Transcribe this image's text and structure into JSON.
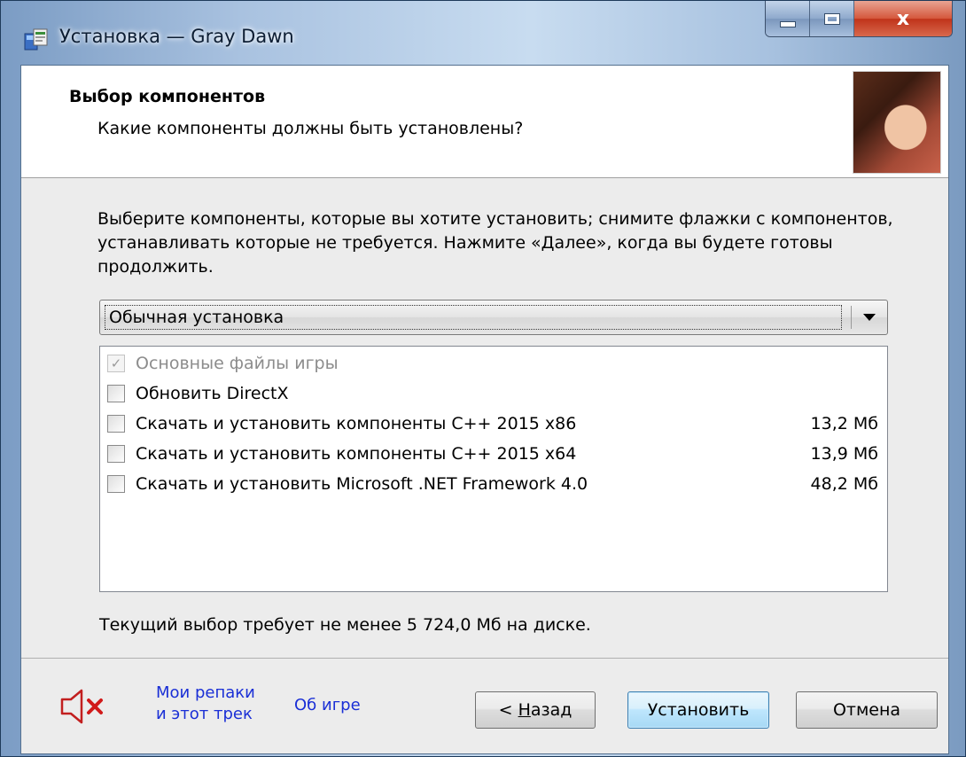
{
  "window": {
    "title": "Установка — Gray Dawn",
    "close_glyph": "x"
  },
  "header": {
    "title": "Выбор компонентов",
    "subtitle": "Какие компоненты должны быть установлены?"
  },
  "intro_text": "Выберите компоненты, которые вы хотите установить; снимите флажки с компонентов, устанавливать которые не требуется. Нажмите «Далее», когда вы будете готовы продолжить.",
  "setup_type": {
    "selected": "Обычная установка"
  },
  "components": [
    {
      "label": "Основные файлы игры",
      "size": "",
      "checked": true,
      "disabled": true
    },
    {
      "label": "Обновить DirectX",
      "size": "",
      "checked": false,
      "disabled": false
    },
    {
      "label": "Скачать и установить компоненты C++ 2015 x86",
      "size": "13,2 Мб",
      "checked": false,
      "disabled": false
    },
    {
      "label": "Скачать и установить компоненты C++ 2015 x64",
      "size": "13,9 Мб",
      "checked": false,
      "disabled": false
    },
    {
      "label": "Скачать и установить Microsoft .NET Framework 4.0",
      "size": "48,2 Мб",
      "checked": false,
      "disabled": false
    }
  ],
  "disk_space_text": "Текущий выбор требует не менее 5 724,0 Мб на диске.",
  "footer": {
    "speaker_icon": "speaker-muted-icon",
    "link_music_line1": "Мои репаки",
    "link_music_line2": "и этот трек",
    "link_about": "Об игре",
    "back_prefix": "< ",
    "back_accel": "Н",
    "back_rest": "азад",
    "install_label": "Установить",
    "cancel_label": "Отмена"
  },
  "colors": {
    "link": "#1a2fd6",
    "mute_x": "#d11a1a",
    "speaker": "#c21f1f"
  }
}
